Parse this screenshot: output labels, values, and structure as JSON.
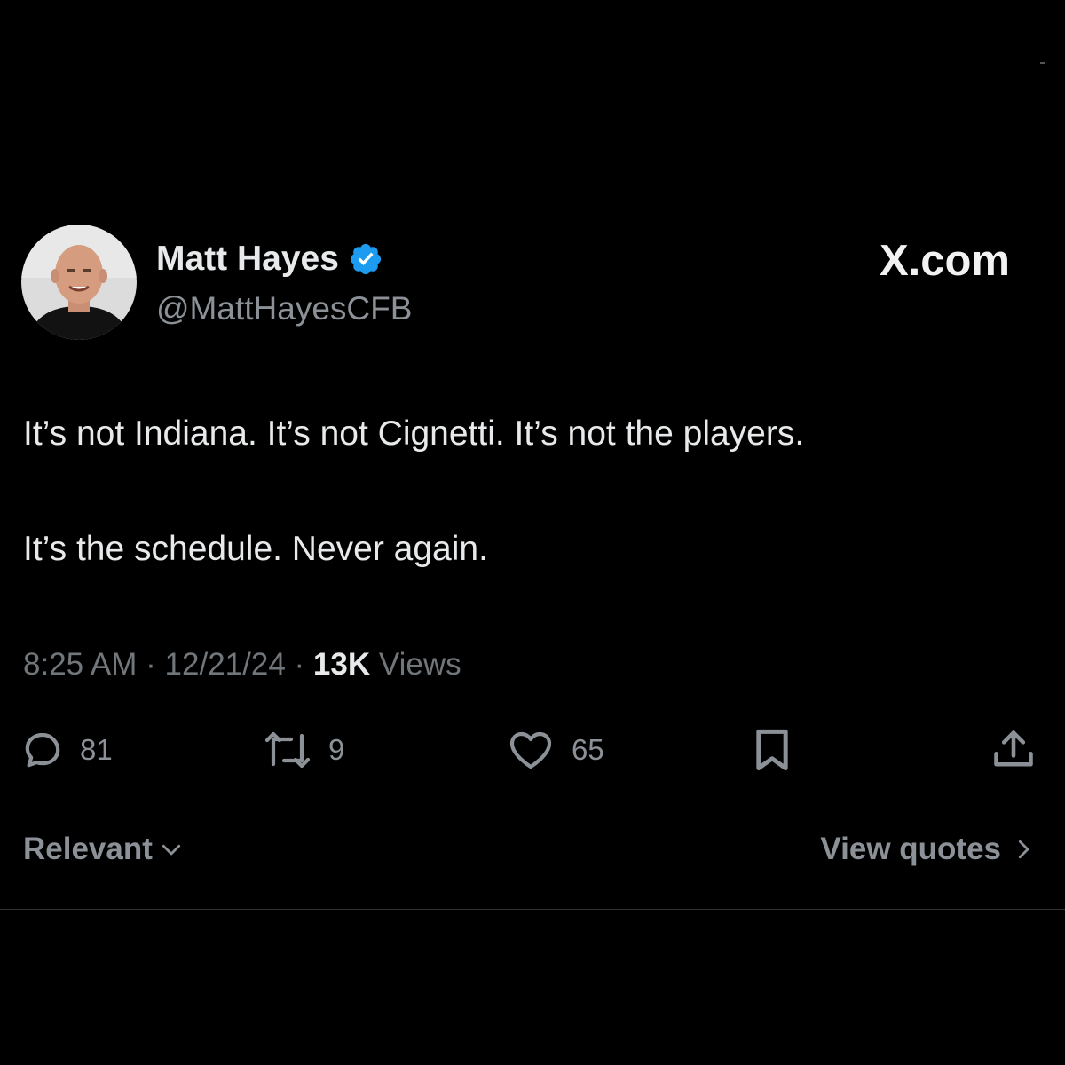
{
  "author": {
    "display_name": "Matt Hayes",
    "handle": "@MattHayesCFB",
    "verified": true,
    "avatar_icon": "profile-photo"
  },
  "brand": {
    "label": "X.com"
  },
  "tweet": {
    "paragraphs": [
      "It’s not Indiana. It’s not Cignetti. It’s not the players.",
      "It’s the schedule. Never again."
    ]
  },
  "meta": {
    "time": "8:25 AM",
    "separator": "·",
    "date": "12/21/24",
    "views_count": "13K",
    "views_label": "Views"
  },
  "actions": {
    "replies": "81",
    "reposts": "9",
    "likes": "65"
  },
  "footer": {
    "sort_label": "Relevant",
    "quotes_label": "View quotes"
  },
  "colors": {
    "background": "#000000",
    "verified_badge": "#1d9bf0",
    "secondary_text": "#8b9197"
  }
}
